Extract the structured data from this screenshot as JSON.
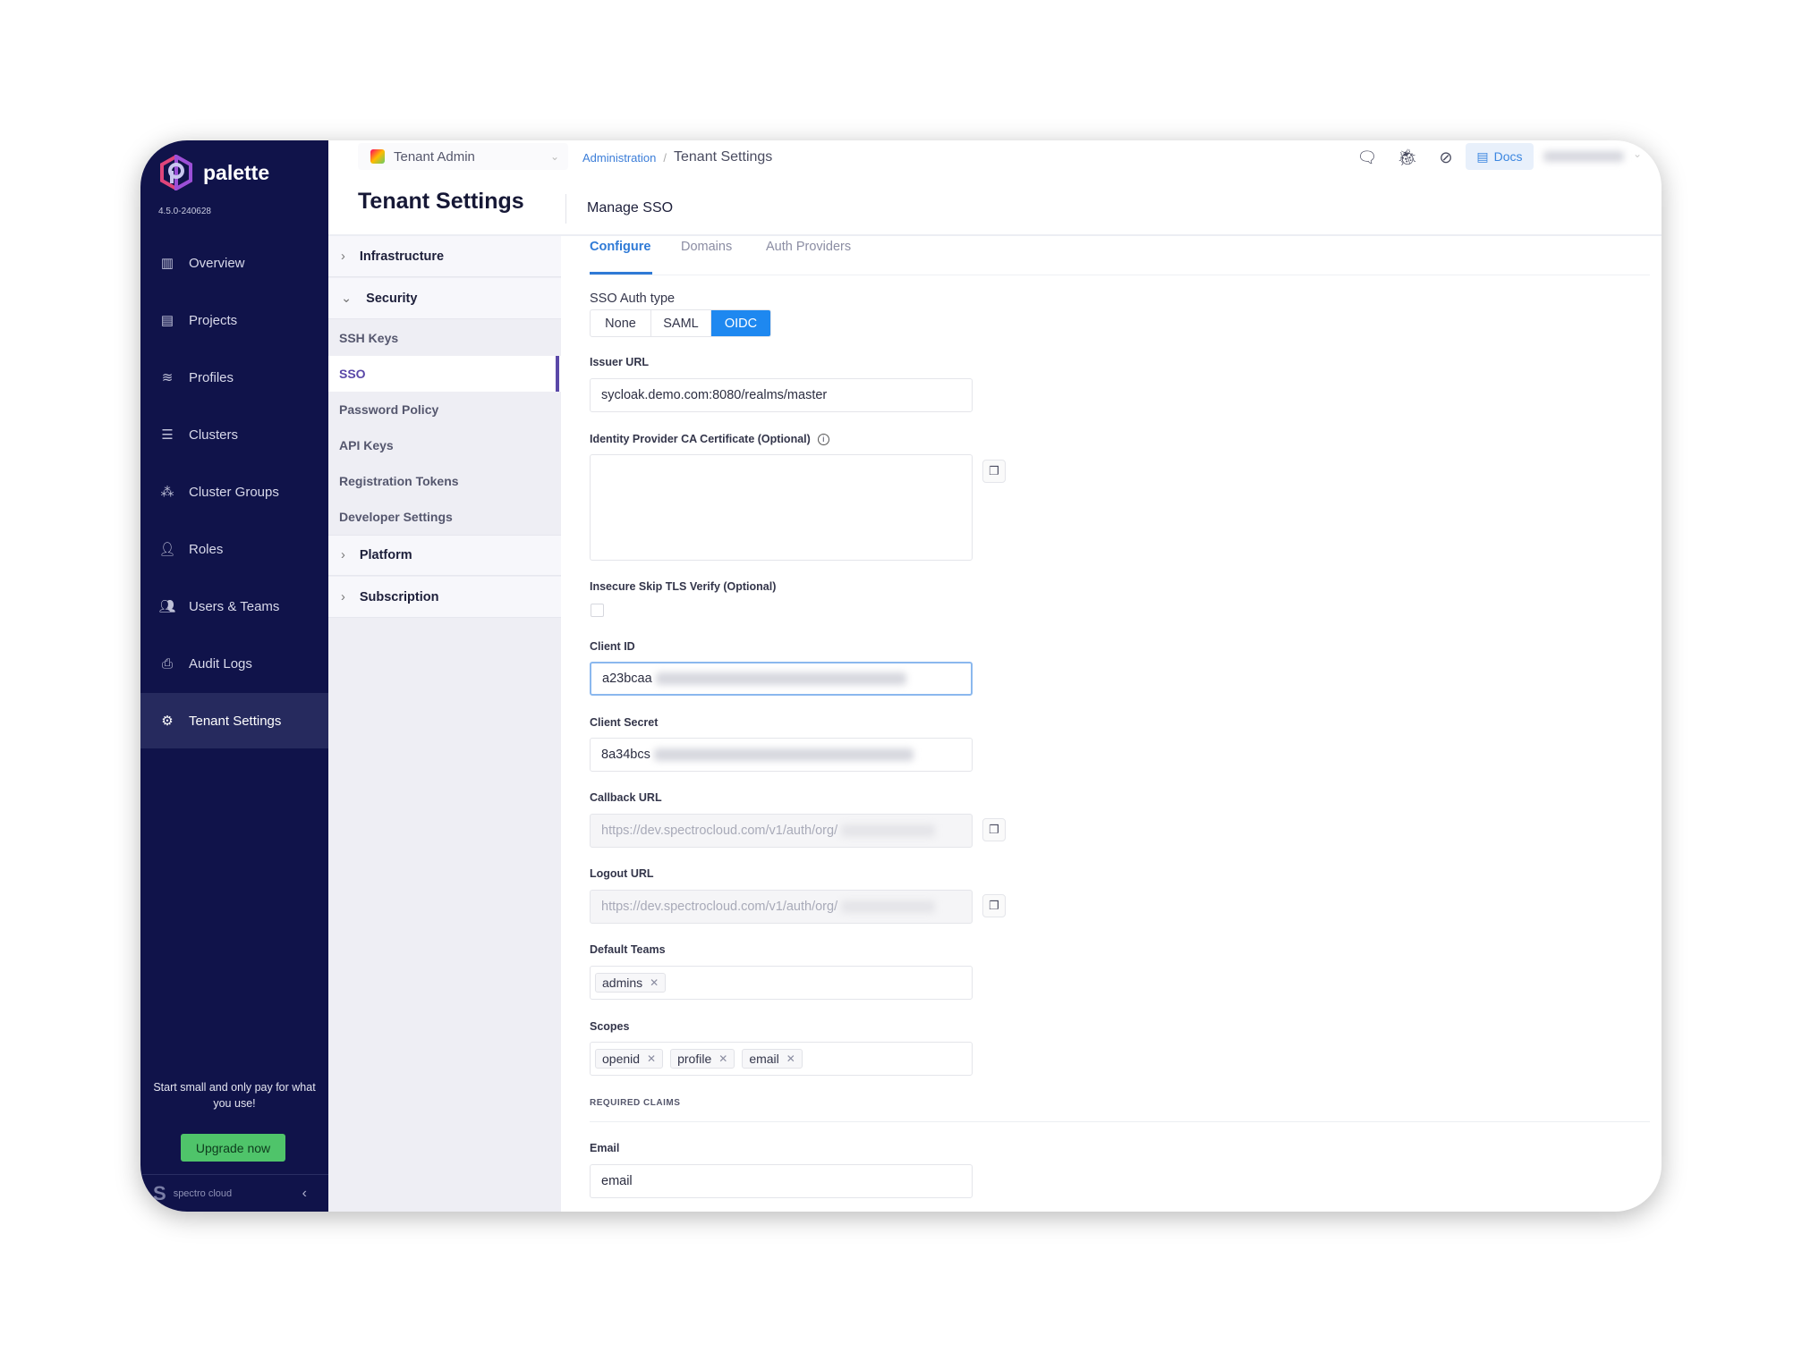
{
  "app": {
    "name": "palette",
    "version": "4.5.0-240628",
    "brand_color": "#10134a",
    "accent": "#1e88f0"
  },
  "sidebar": {
    "items": [
      {
        "label": "Overview",
        "icon": "chart-icon"
      },
      {
        "label": "Projects",
        "icon": "bar-chart-icon"
      },
      {
        "label": "Profiles",
        "icon": "database-icon"
      },
      {
        "label": "Clusters",
        "icon": "list-icon"
      },
      {
        "label": "Cluster Groups",
        "icon": "nodes-icon"
      },
      {
        "label": "Roles",
        "icon": "user-icon"
      },
      {
        "label": "Users & Teams",
        "icon": "users-icon"
      },
      {
        "label": "Audit Logs",
        "icon": "search-doc-icon"
      },
      {
        "label": "Tenant Settings",
        "icon": "gear-icon",
        "active": true
      }
    ],
    "promo": "Start small and only pay for what you use!",
    "upgrade_label": "Upgrade now",
    "footer_brand": "spectro cloud"
  },
  "topbar": {
    "scope": "Tenant Admin",
    "breadcrumb": [
      "Administration",
      "Tenant Settings"
    ],
    "docs_label": "Docs"
  },
  "header": {
    "title": "Tenant Settings",
    "subtitle": "Manage SSO"
  },
  "menu": {
    "infrastructure": "Infrastructure",
    "security": "Security",
    "security_items": [
      "SSH Keys",
      "SSO",
      "Password Policy",
      "API Keys",
      "Registration Tokens",
      "Developer Settings"
    ],
    "platform": "Platform",
    "subscription": "Subscription"
  },
  "tabs": [
    "Configure",
    "Domains",
    "Auth Providers"
  ],
  "form": {
    "auth_type_label": "SSO Auth type",
    "auth_types": [
      "None",
      "SAML",
      "OIDC"
    ],
    "auth_type_selected": "OIDC",
    "issuer_label": "Issuer URL",
    "issuer_value": "sycloak.demo.com:8080/realms/master",
    "ca_label": "Identity Provider CA Certificate (Optional)",
    "tls_label": "Insecure Skip TLS Verify (Optional)",
    "tls_checked": false,
    "client_id_label": "Client ID",
    "client_id_value": "a23bcaa",
    "client_secret_label": "Client Secret",
    "client_secret_value": "8a34bcs",
    "callback_label": "Callback URL",
    "callback_value": "https://dev.spectrocloud.com/v1/auth/org/",
    "logout_label": "Logout URL",
    "logout_value": "https://dev.spectrocloud.com/v1/auth/org/",
    "teams_label": "Default Teams",
    "teams": [
      "admins"
    ],
    "scopes_label": "Scopes",
    "scopes": [
      "openid",
      "profile",
      "email"
    ],
    "claims_heading": "REQUIRED CLAIMS",
    "email_label": "Email",
    "email_value": "email"
  }
}
